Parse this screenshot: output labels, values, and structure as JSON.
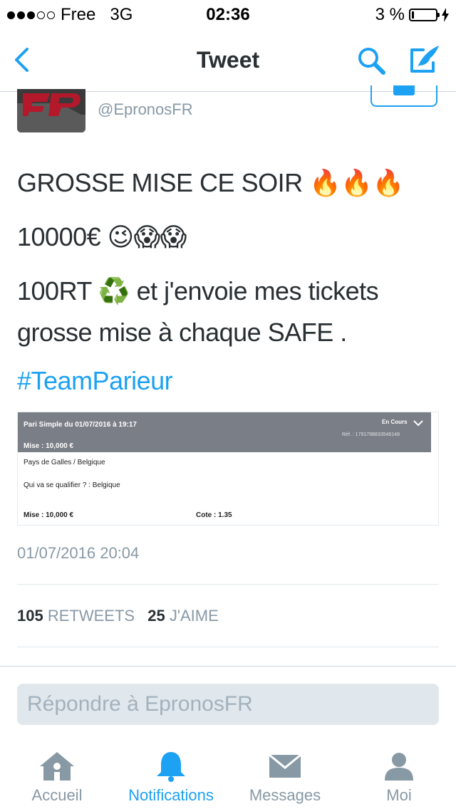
{
  "status_bar": {
    "carrier": "Free",
    "network": "3G",
    "time": "02:36",
    "battery": "3 %"
  },
  "nav": {
    "title": "Tweet",
    "back_icon": "chevron-left-icon",
    "search_icon": "search-icon",
    "compose_icon": "compose-quill-icon"
  },
  "tweet": {
    "author_handle": "@EpronosFR",
    "lines": [
      "GROSSE MISE CE SOIR 🔥🔥🔥",
      "10000€ 😉😱😱",
      "100RT ♻️ et j'envoie mes tickets",
      "grosse mise à chaque SAFE ."
    ],
    "hashtag": "#TeamParieur",
    "timestamp": "01/07/2016 20:04"
  },
  "ticket": {
    "title": "Pari Simple  du 01/07/2016 à 19:17",
    "status": "En Cours",
    "ref": "Réf. : 1791798833546148",
    "stake_header": "Mise : 10,000 €",
    "match": "Pays de Galles / Belgique",
    "question": "Qui va se qualifier ? : Belgique",
    "stake": "Mise : 10,000 €",
    "odds": "Cote : 1.35"
  },
  "stats": {
    "retweets_count": "105",
    "retweets_label": "RETWEETS",
    "likes_count": "25",
    "likes_label": "J'AIME"
  },
  "reply": {
    "placeholder": "Répondre à EpronosFR"
  },
  "tabs": [
    {
      "label": "Accueil",
      "icon": "home-icon"
    },
    {
      "label": "Notifications",
      "icon": "bell-icon"
    },
    {
      "label": "Messages",
      "icon": "envelope-icon"
    },
    {
      "label": "Moi",
      "icon": "person-icon"
    }
  ],
  "colors": {
    "accent": "#1da1f2",
    "text": "#292f33",
    "muted": "#8899a6"
  }
}
